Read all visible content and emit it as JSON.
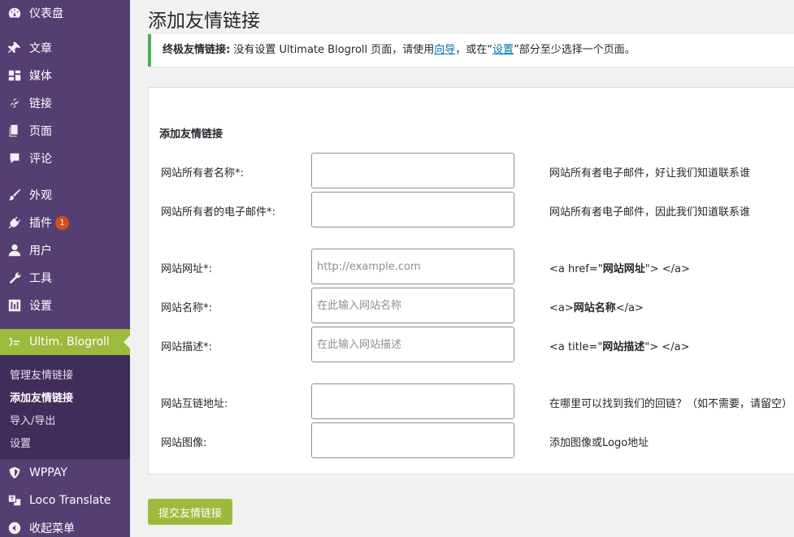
{
  "sidebar": {
    "items": [
      {
        "label": "仪表盘",
        "icon": "dashboard-icon"
      },
      {
        "label": "文章",
        "icon": "pin-icon"
      },
      {
        "label": "媒体",
        "icon": "media-icon"
      },
      {
        "label": "链接",
        "icon": "link-icon"
      },
      {
        "label": "页面",
        "icon": "page-icon"
      },
      {
        "label": "评论",
        "icon": "comment-icon"
      },
      {
        "label": "外观",
        "icon": "brush-icon"
      },
      {
        "label": "插件",
        "icon": "plugin-icon",
        "badge": "1"
      },
      {
        "label": "用户",
        "icon": "user-icon"
      },
      {
        "label": "工具",
        "icon": "wrench-icon"
      },
      {
        "label": "设置",
        "icon": "settings-icon"
      },
      {
        "label": "Ultim. Blogroll",
        "icon": "blogroll-icon"
      },
      {
        "label": "WPPAY",
        "icon": "shield-icon"
      },
      {
        "label": "Loco Translate",
        "icon": "translate-icon"
      },
      {
        "label": "收起菜单",
        "icon": "collapse-icon"
      }
    ],
    "submenu": [
      "管理友情链接",
      "添加友情链接",
      "导入/导出",
      "设置"
    ]
  },
  "page": {
    "title": "添加友情链接"
  },
  "notice": {
    "strong": "终极友情链接:",
    "text1": " 没有设置 Ultimate Blogroll 页面，请使用",
    "link1": "向导",
    "text2": "，或在“",
    "link2": "设置",
    "text3": "”部分至少选择一个页面。"
  },
  "form": {
    "heading": "添加友情链接",
    "rows": [
      {
        "label": "网站所有者名称*:",
        "placeholder": "",
        "hint": "网站所有者电子邮件，好让我们知道联系谁"
      },
      {
        "label": "网站所有者的电子邮件*:",
        "placeholder": "",
        "hint": "网站所有者电子邮件，因此我们知道联系谁"
      },
      {
        "label": "网站网址*:",
        "placeholder": "http://example.com",
        "hint_pre": "<a href=\"",
        "hint_bold": "网站网址",
        "hint_post": "\"> </a>"
      },
      {
        "label": "网站名称*:",
        "placeholder": "在此输入网站名称",
        "hint_pre": "<a>",
        "hint_bold": "网站名称",
        "hint_post": "</a>"
      },
      {
        "label": "网站描述*:",
        "placeholder": "在此输入网站描述",
        "hint_pre": "<a title=\"",
        "hint_bold": "网站描述",
        "hint_post": "\"> </a>"
      },
      {
        "label": "网站互链地址:",
        "placeholder": "",
        "hint": "在哪里可以找到我们的回链？（如不需要，请留空）"
      },
      {
        "label": "网站图像:",
        "placeholder": "",
        "hint": "添加图像或Logo地址"
      }
    ],
    "submit": "提交友情链接"
  }
}
